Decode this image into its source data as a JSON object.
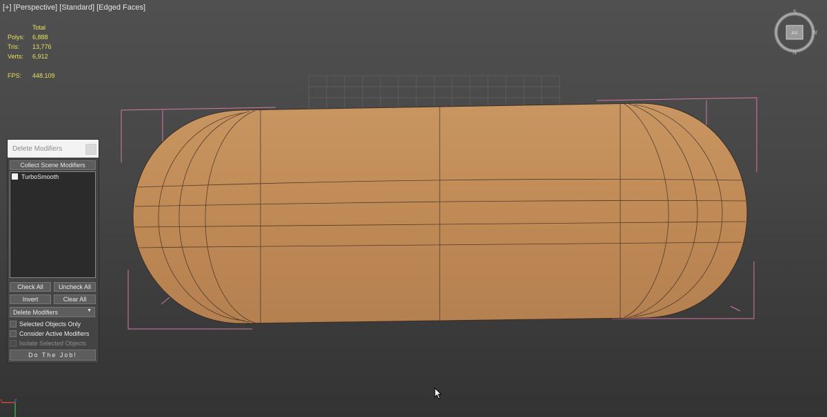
{
  "viewport": {
    "label_parts": [
      "[+]",
      "[Perspective]",
      "[Standard]",
      "[Edged Faces]"
    ],
    "stats": {
      "header": "Total",
      "rows": [
        {
          "key": "Polys:",
          "value": "6,888"
        },
        {
          "key": "Tris:",
          "value": "13,776"
        },
        {
          "key": "Verts:",
          "value": "6,912"
        }
      ],
      "fps_key": "FPS:",
      "fps_value": "448.109"
    },
    "viewcube": {
      "n": "N",
      "s": "S",
      "w": "W",
      "cube": "AX"
    },
    "axis": {
      "x": "x",
      "z": "z"
    }
  },
  "panel": {
    "title": "Delete Modifiers",
    "collect_label": "Collect Scene Modifiers",
    "list_items": [
      {
        "label": "TurboSmooth",
        "checked": false
      }
    ],
    "check_all": "Check All",
    "uncheck_all": "Uncheck All",
    "invert": "Invert",
    "clear_all": "Clear All",
    "mode_selected": "Delete Modifiers",
    "options": [
      {
        "label": "Selected Objects Only",
        "enabled": true
      },
      {
        "label": "Consider Active Modifiers",
        "enabled": true
      },
      {
        "label": "Isolate Selected Objects",
        "enabled": false
      }
    ],
    "do_job": "Do The Job!"
  },
  "colors": {
    "wood": "#c4905d",
    "bbox": "#d37aa6",
    "stats_text": "#e9e05a",
    "wire": "#3a2c22"
  }
}
